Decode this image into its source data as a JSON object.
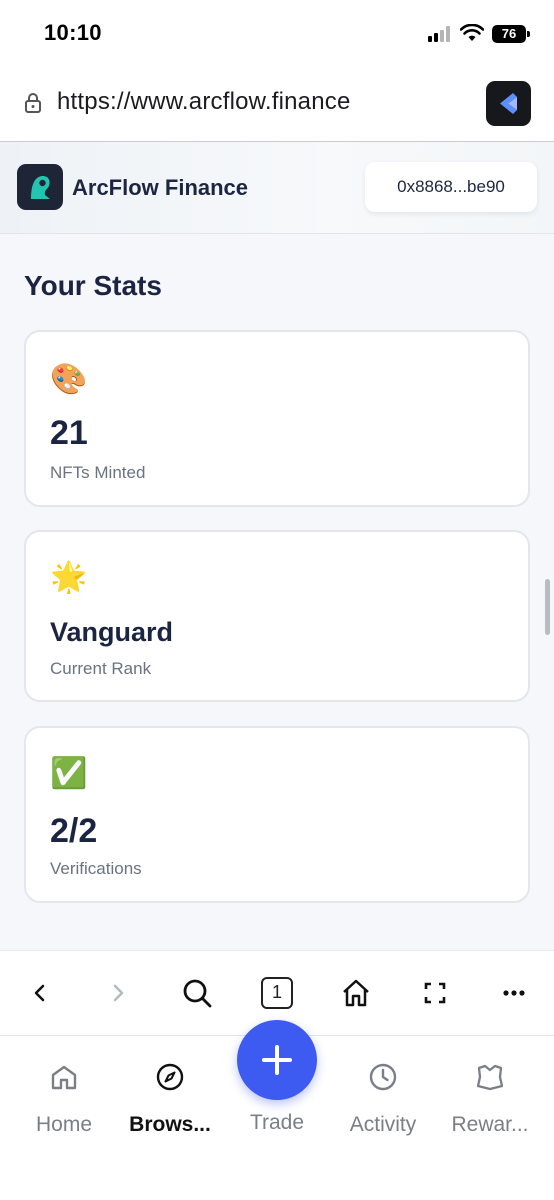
{
  "status_bar": {
    "time": "10:10",
    "battery": "76"
  },
  "browser": {
    "url": "https://www.arcflow.finance",
    "tab_count": "1"
  },
  "app": {
    "name": "ArcFlow Finance",
    "wallet_address": "0x8868...be90"
  },
  "stats": {
    "title": "Your Stats",
    "cards": [
      {
        "emoji": "🎨",
        "value": "21",
        "label": "NFTs Minted"
      },
      {
        "emoji": "🌟",
        "value": "Vanguard",
        "label": "Current Rank"
      },
      {
        "emoji": "✅",
        "value": "2/2",
        "label": "Verifications"
      }
    ]
  },
  "bottom_nav": {
    "items": [
      {
        "label": "Home",
        "icon": "home-icon"
      },
      {
        "label": "Brows...",
        "icon": "compass-icon"
      },
      {
        "label": "Trade",
        "icon": "plus-icon"
      },
      {
        "label": "Activity",
        "icon": "clock-icon"
      },
      {
        "label": "Rewar...",
        "icon": "rewards-icon"
      }
    ]
  },
  "colors": {
    "accent": "#3d5af1",
    "text_primary": "#1b2440",
    "text_secondary": "#6b7280"
  }
}
